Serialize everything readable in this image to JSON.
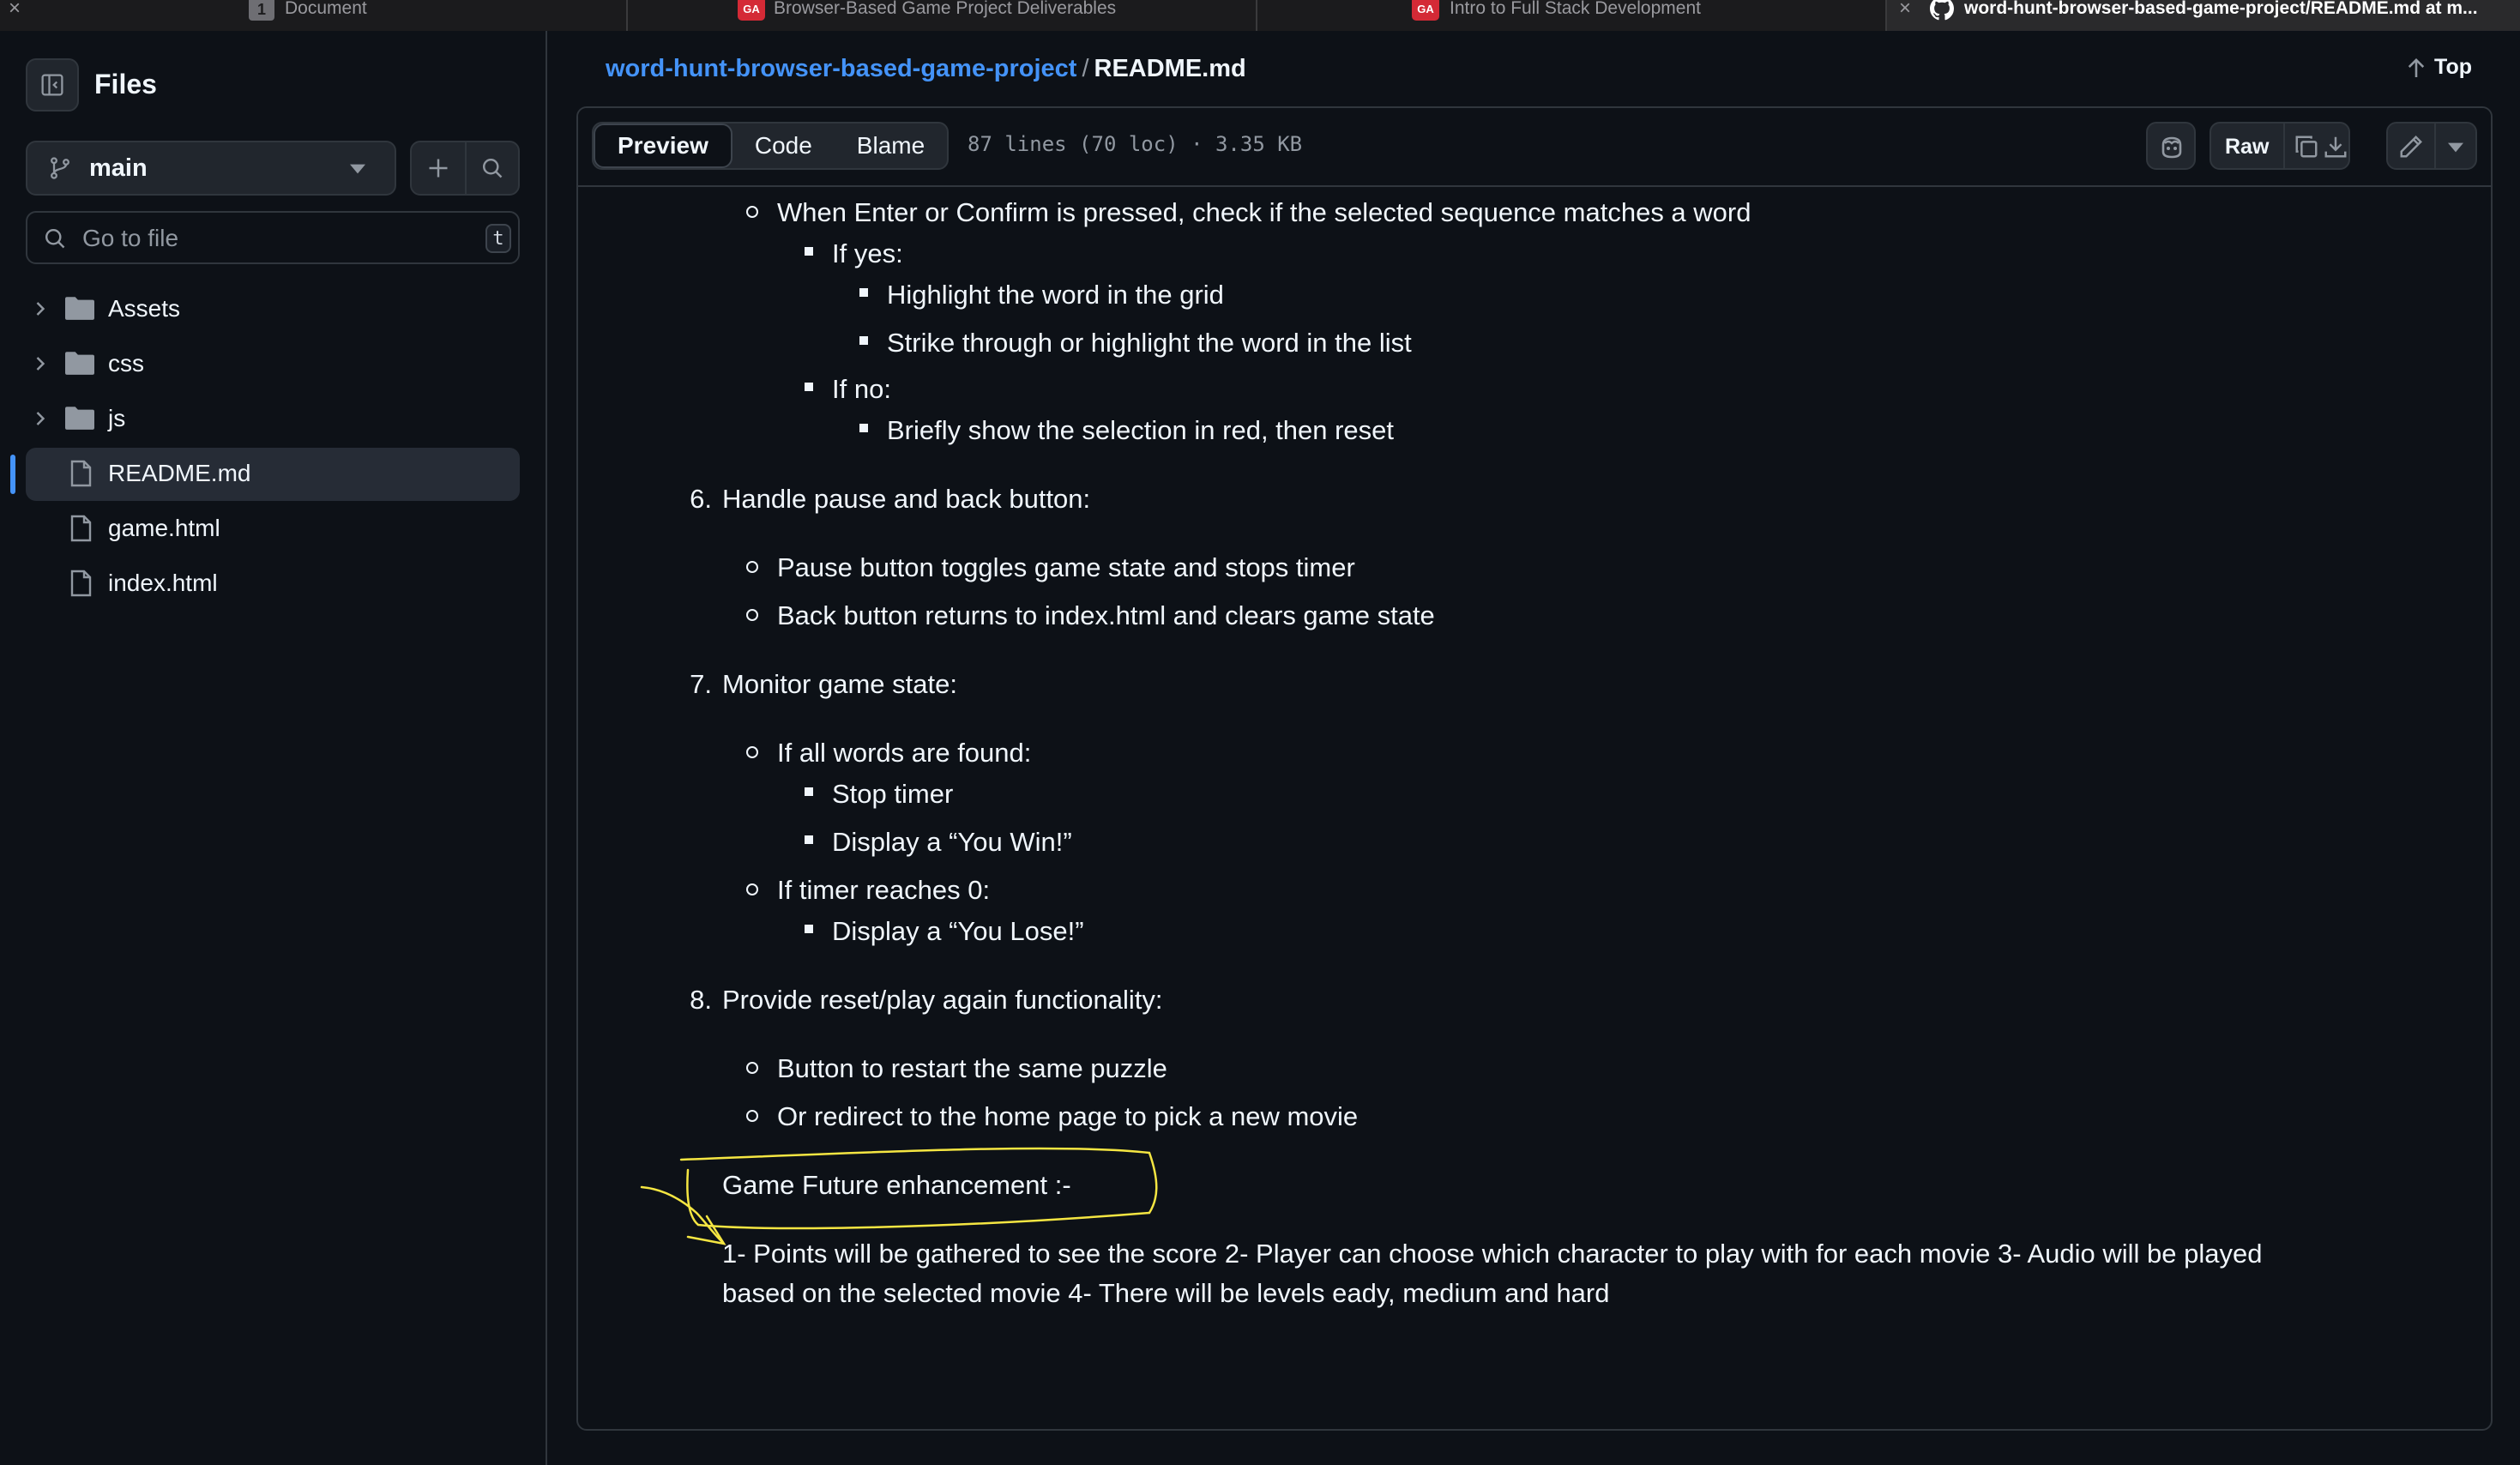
{
  "browser_tabs": [
    {
      "label": "Document",
      "badge": "1"
    },
    {
      "label": "Browser-Based Game Project Deliverables",
      "favicon": "GA"
    },
    {
      "label": "Intro to Full Stack Development",
      "favicon": "GA"
    },
    {
      "label": "word-hunt-browser-based-game-project/README.md at m...",
      "icon": "github-icon",
      "active": true
    }
  ],
  "sidebar": {
    "title": "Files",
    "branch": "main",
    "search_placeholder": "Go to file",
    "shortcut_key": "t",
    "items": [
      {
        "label": "Assets",
        "type": "folder"
      },
      {
        "label": "css",
        "type": "folder"
      },
      {
        "label": "js",
        "type": "folder"
      },
      {
        "label": "README.md",
        "type": "file",
        "selected": true
      },
      {
        "label": "game.html",
        "type": "file"
      },
      {
        "label": "index.html",
        "type": "file"
      }
    ]
  },
  "header": {
    "repo": "word-hunt-browser-based-game-project",
    "separator": "/",
    "file": "README.md",
    "top_label": "Top"
  },
  "file_toolbar": {
    "tabs": [
      "Preview",
      "Code",
      "Blame"
    ],
    "active_tab": "Preview",
    "meta": "87 lines (70 loc) · 3.35 KB",
    "raw_label": "Raw"
  },
  "content": {
    "l1": "When Enter or Confirm is pressed, check if the selected sequence matches a word",
    "l2": "If yes:",
    "l3": "Highlight the word in the grid",
    "l4": "Strike through or highlight the word in the list",
    "l5": "If no:",
    "l6": "Briefly show the selection in red, then reset",
    "n6": "6.",
    "s6": "Handle pause and back button:",
    "l7": "Pause button toggles game state and stops timer",
    "l8": "Back button returns to index.html and clears game state",
    "n7": "7.",
    "s7": "Monitor game state:",
    "l9": "If all words are found:",
    "l10": "Stop timer",
    "l11": "Display a “You Win!”",
    "l12": "If timer reaches 0:",
    "l13": "Display a “You Lose!”",
    "n8": "8.",
    "s8": "Provide reset/play again functionality:",
    "l14": "Button to restart the same puzzle",
    "l15": "Or redirect to the home page to pick a new movie",
    "future_heading": "Game Future enhancement :-",
    "future_p1": "1- Points will be gathered to see the score 2- Player can choose which character to play with for each movie 3- Audio will be played",
    "future_p2": "based on the selected movie 4- There will be levels eady, medium and hard"
  },
  "colors": {
    "background": "#0d1117",
    "link": "#4493f8",
    "border": "#30363d",
    "annotation": "#f5e642"
  }
}
